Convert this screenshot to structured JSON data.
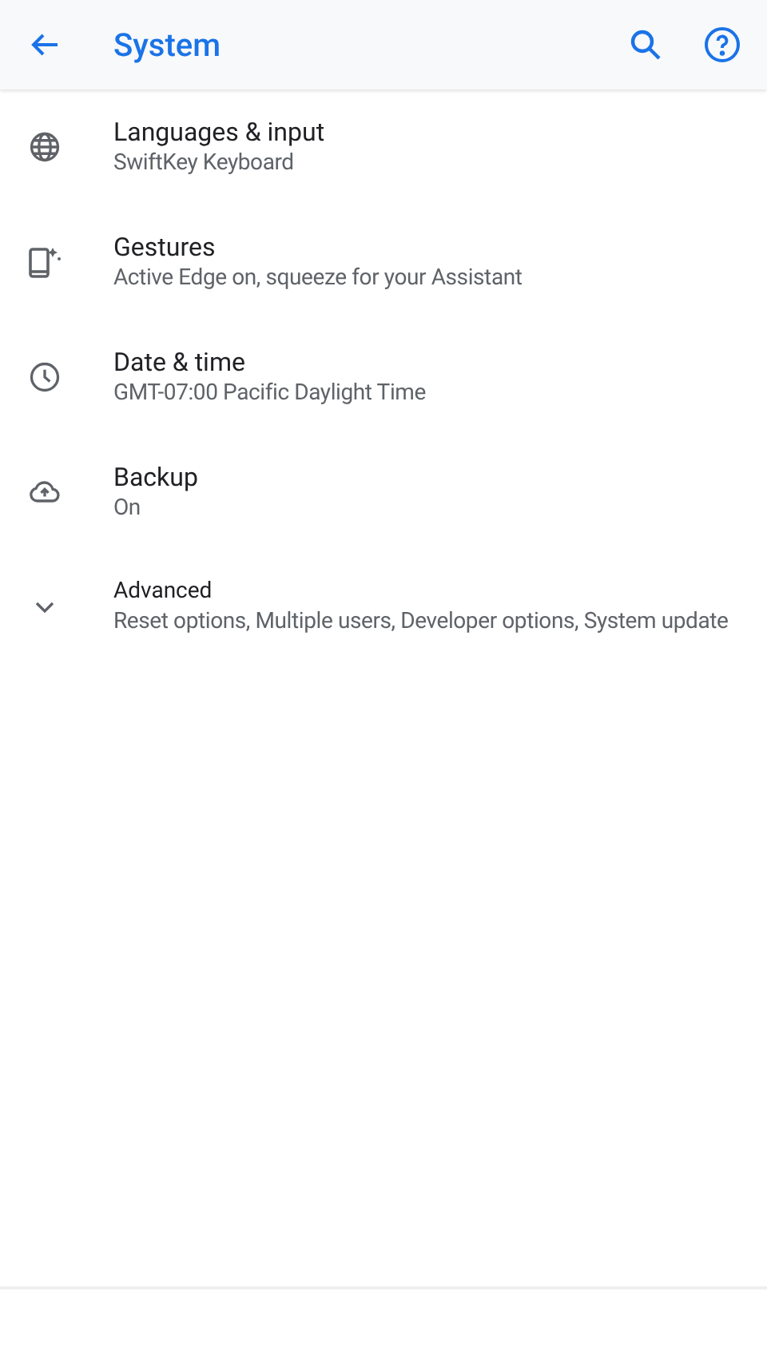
{
  "app_bar": {
    "title": "System"
  },
  "items": [
    {
      "kind": "setting",
      "title": "Languages & input",
      "summary": "SwiftKey Keyboard"
    },
    {
      "kind": "setting",
      "title": "Gestures",
      "summary": "Active Edge on, squeeze for your Assistant"
    },
    {
      "kind": "setting",
      "title": "Date & time",
      "summary": "GMT-07:00 Pacific Daylight Time"
    },
    {
      "kind": "setting",
      "title": "Backup",
      "summary": "On"
    },
    {
      "kind": "expander",
      "title": "Advanced",
      "summary": "Reset options, Multiple users, Developer options, System update"
    }
  ]
}
